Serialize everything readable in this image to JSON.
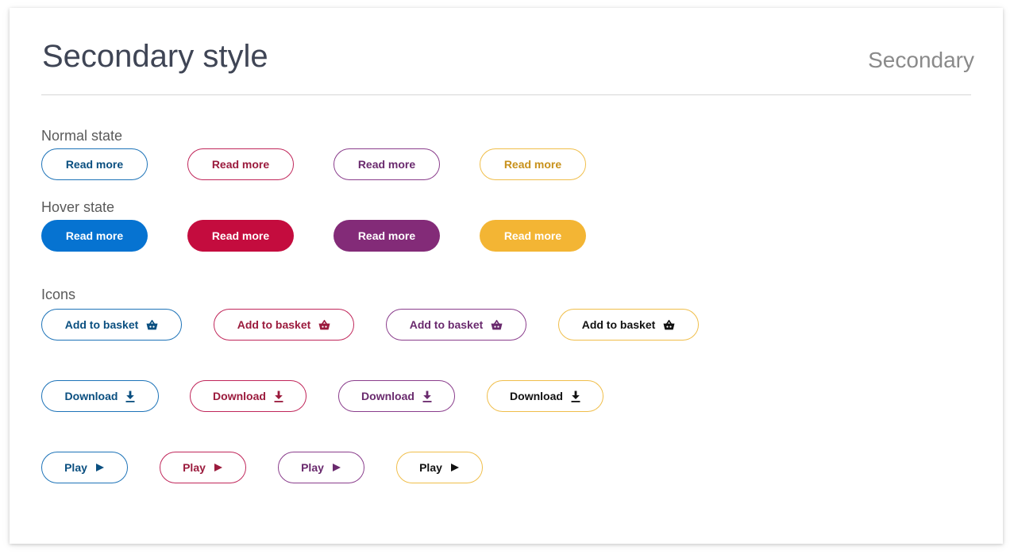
{
  "header": {
    "title": "Secondary style",
    "tag": "Secondary"
  },
  "sections": {
    "normal_label": "Normal state",
    "hover_label": "Hover state",
    "icons_label": "Icons"
  },
  "buttons": {
    "read_more": "Read more",
    "add_to_basket": "Add to basket",
    "download": "Download",
    "play": "Play"
  },
  "colors": {
    "blue": "#0673d1",
    "red": "#c40c3e",
    "purple": "#832b78",
    "yellow": "#f3b534",
    "title_text": "#3f4555"
  },
  "icons": {
    "basket": "basket-icon",
    "download": "download-icon",
    "play": "play-icon"
  }
}
